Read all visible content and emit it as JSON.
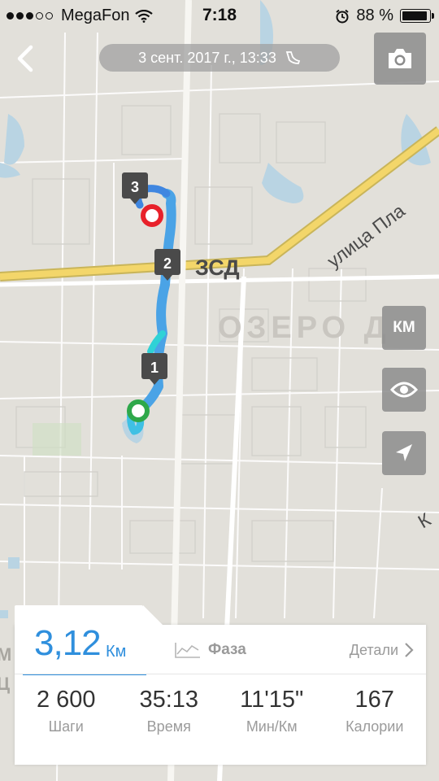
{
  "status_bar": {
    "carrier": "MegaFon",
    "time": "7:18",
    "battery": "88 %"
  },
  "header": {
    "date": "3 сент. 2017 г., 13:33"
  },
  "map": {
    "labels": {
      "highway": "ЗСД",
      "street": "улица Пла",
      "lake": "ОЗЕРО Д",
      "partial_k": "К",
      "left_m": "M",
      "left_c": "Ц"
    },
    "markers": [
      "1",
      "2",
      "3"
    ]
  },
  "controls": {
    "km_label": "КМ"
  },
  "summary": {
    "distance_value": "3,12",
    "distance_unit": "Км",
    "phase_label": "Фаза",
    "details_label": "Детали",
    "stats": [
      {
        "value": "2 600",
        "label": "Шаги"
      },
      {
        "value": "35:13",
        "label": "Время"
      },
      {
        "value": "11'15\"",
        "label": "Мин/Км"
      },
      {
        "value": "167",
        "label": "Калории"
      }
    ]
  },
  "colors": {
    "accent": "#2f8fdd",
    "route_start": "#2ea84a",
    "route_end": "#e8212a"
  }
}
